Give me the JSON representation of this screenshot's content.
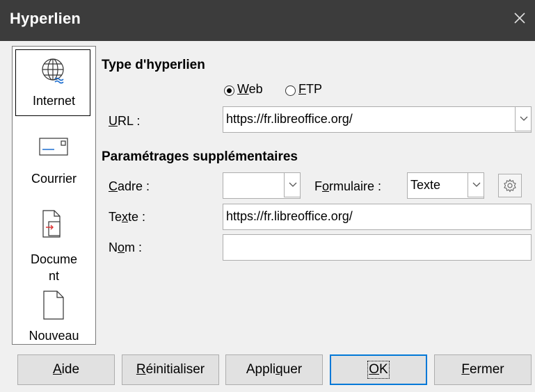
{
  "window": {
    "title": "Hyperlien"
  },
  "sidebar": {
    "items": [
      {
        "label": "Internet",
        "icon": "globe-icon",
        "selected": true
      },
      {
        "label": "Courrier",
        "icon": "envelope-icon"
      },
      {
        "label": "Docume nt",
        "line1": "Docume",
        "line2": "nt",
        "icon": "document-icon"
      },
      {
        "label": "Nouveau",
        "icon": "new-document-icon"
      }
    ]
  },
  "main": {
    "type_heading": "Type d'hyperlien",
    "radio_web": "Web",
    "radio_ftp": "FTP",
    "url_label": "URL :",
    "url_value": "https://fr.libreoffice.org/",
    "settings_heading": "Paramétrages supplémentaires",
    "cadre_label": "Cadre :",
    "cadre_value": "",
    "formulaire_label": "Formulaire :",
    "formulaire_value": "Texte",
    "texte_label": "Texte :",
    "texte_value": "https://fr.libreoffice.org/",
    "nom_label": "Nom :",
    "nom_value": ""
  },
  "buttons": {
    "aide": "Aide",
    "reinitialiser": "Réinitialiser",
    "appliquer": "Appliquer",
    "ok": "OK",
    "fermer": "Fermer"
  },
  "colors": {
    "titlebar": "#3c3c3c",
    "accent": "#0078d7",
    "dialog_bg": "#f0f0f0"
  }
}
